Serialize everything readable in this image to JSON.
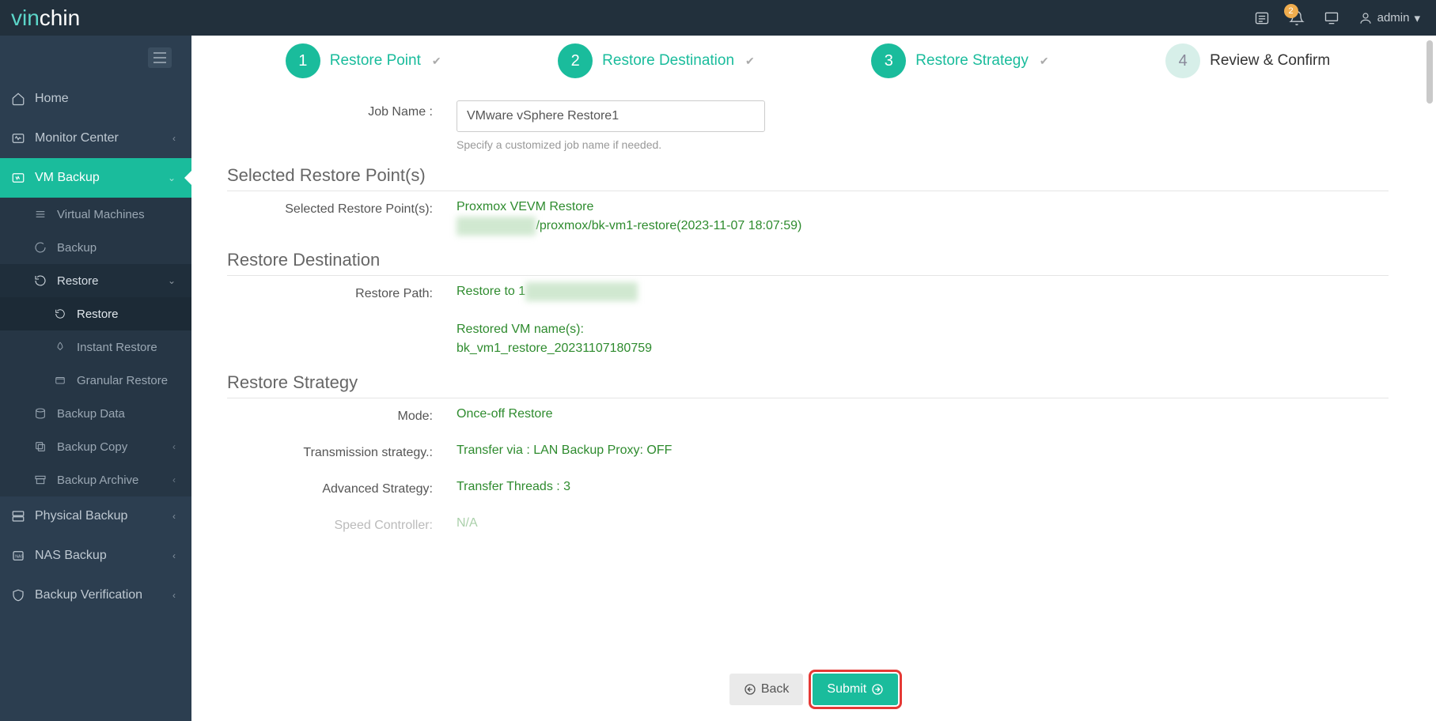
{
  "brand": {
    "part1": "vin",
    "part2": "chin"
  },
  "topbar": {
    "notif_count": "2",
    "user": "admin"
  },
  "sidebar": {
    "home": "Home",
    "monitor": "Monitor Center",
    "vm_backup": "VM Backup",
    "virtual_machines": "Virtual Machines",
    "backup": "Backup",
    "restore": "Restore",
    "restore_sub": "Restore",
    "instant_restore": "Instant Restore",
    "granular_restore": "Granular Restore",
    "backup_data": "Backup Data",
    "backup_copy": "Backup Copy",
    "backup_archive": "Backup Archive",
    "physical_backup": "Physical Backup",
    "nas_backup": "NAS Backup",
    "backup_verification": "Backup Verification"
  },
  "steps": {
    "s1": "Restore Point",
    "s2": "Restore Destination",
    "s3": "Restore Strategy",
    "s4": "Review & Confirm"
  },
  "form": {
    "job_name_label": "Job Name :",
    "job_name_value": "VMware vSphere Restore1",
    "job_name_hint": "Specify a customized job name if needed."
  },
  "sections": {
    "restore_point": {
      "title": "Selected Restore Point(s)",
      "label": "Selected Restore Point(s):",
      "val1": "Proxmox VEVM Restore",
      "val2_masked": "xxxxx xxxxxxx",
      "val2b": "/proxmox/bk-vm1-restore(2023-11-07 18:07:59)"
    },
    "destination": {
      "title": "Restore Destination",
      "path_label": "Restore Path:",
      "path_val_prefix": "Restore to 1",
      "path_val_mask": "xx xxxxxx xx xxxxxx",
      "names_label": "Restored VM name(s):",
      "names_val": "bk_vm1_restore_20231107180759"
    },
    "strategy": {
      "title": "Restore Strategy",
      "mode_label": "Mode:",
      "mode_val": "Once-off Restore",
      "trans_label": "Transmission strategy.:",
      "trans_val": "Transfer via : LAN Backup Proxy: OFF",
      "adv_label": "Advanced Strategy:",
      "adv_val": "Transfer Threads : 3",
      "speed_label": "Speed Controller:",
      "speed_val": "N/A"
    }
  },
  "buttons": {
    "back": "Back",
    "submit": "Submit"
  }
}
